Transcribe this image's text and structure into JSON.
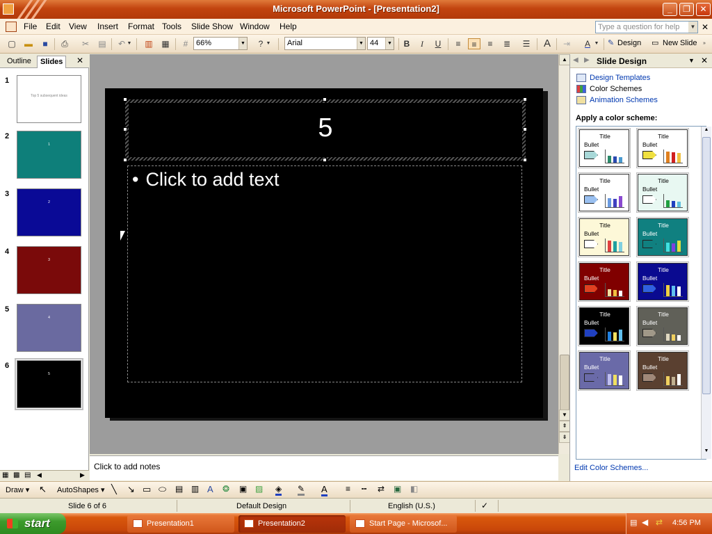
{
  "window": {
    "title": "Microsoft PowerPoint - [Presentation2]"
  },
  "menu": {
    "items": [
      "File",
      "Edit",
      "View",
      "Insert",
      "Format",
      "Tools",
      "Slide Show",
      "Window",
      "Help"
    ],
    "ask_placeholder": "Type a question for help"
  },
  "toolbar": {
    "zoom": "66%",
    "font": "Arial",
    "font_size": "44",
    "design_label": "Design",
    "new_slide_label": "New Slide"
  },
  "left_pane": {
    "tabs": [
      "Outline",
      "Slides"
    ],
    "active_tab": "Slides",
    "slides": [
      {
        "num": "1",
        "bg": "#ffffff",
        "text": "Top 5 subsequent ideas",
        "text_color": "#888888"
      },
      {
        "num": "2",
        "bg": "#0e7f7a",
        "text": "1",
        "text_color": "#ffffff"
      },
      {
        "num": "3",
        "bg": "#0a0a96",
        "text": "2",
        "text_color": "#ffffff"
      },
      {
        "num": "4",
        "bg": "#7a0a0a",
        "text": "3",
        "text_color": "#ffffff"
      },
      {
        "num": "5",
        "bg": "#6a6aa0",
        "text": "4",
        "text_color": "#ffffff"
      },
      {
        "num": "6",
        "bg": "#000000",
        "text": "5",
        "text_color": "#ffffff"
      }
    ],
    "selected_slide": 6
  },
  "slide": {
    "title": "5",
    "body_placeholder": "Click to add text",
    "bullet": "•"
  },
  "notes": {
    "placeholder": "Click to add notes"
  },
  "task_pane": {
    "title": "Slide Design",
    "links": [
      "Design Templates",
      "Color Schemes",
      "Animation Schemes"
    ],
    "heading": "Apply a color scheme:",
    "scheme_title": "Title",
    "scheme_bullet": "Bullet",
    "schemes": [
      {
        "bg": "#ffffff",
        "text": "#000000",
        "arrow": "#a8d8d8",
        "bars": [
          "#2a8a6a",
          "#2a4ab0",
          "#4a9ad0"
        ]
      },
      {
        "bg": "#ffffff",
        "text": "#000000",
        "arrow": "#f0e040",
        "bars": [
          "#e08020",
          "#d02020",
          "#f0c040"
        ]
      },
      {
        "bg": "#ffffff",
        "text": "#000000",
        "arrow": "#9ac0f0",
        "bars": [
          "#6a9ae0",
          "#4040c0",
          "#8a4ad0"
        ]
      },
      {
        "bg": "#e8f8f2",
        "text": "#000000",
        "arrow": "#ffffff",
        "bars": [
          "#20a040",
          "#2040c0",
          "#60c0e0"
        ]
      },
      {
        "bg": "#fdf8d8",
        "text": "#000000",
        "arrow": "#ffffff",
        "bars": [
          "#e04040",
          "#20a0a0",
          "#80d0e0"
        ]
      },
      {
        "bg": "#108080",
        "text": "#ffffff",
        "arrow": "#108080",
        "bars": [
          "#40e0e0",
          "#8040e0",
          "#e0e040"
        ]
      },
      {
        "bg": "#800000",
        "text": "#ffffff",
        "arrow": "#e04020",
        "bars": [
          "#f0e0a0",
          "#f0c040",
          "#ffffff"
        ]
      },
      {
        "bg": "#0a0a90",
        "text": "#ffffff",
        "arrow": "#3060e0",
        "bars": [
          "#f0d040",
          "#60c0f0",
          "#ffffff"
        ]
      },
      {
        "bg": "#000000",
        "text": "#ffffff",
        "arrow": "#2040c0",
        "bars": [
          "#2080e0",
          "#f0e060",
          "#60c0f0"
        ]
      },
      {
        "bg": "#606058",
        "text": "#ffffff",
        "arrow": "#a09888",
        "bars": [
          "#e0d8c0",
          "#f0d060",
          "#ffffff"
        ]
      },
      {
        "bg": "#6a6aa8",
        "text": "#ffffff",
        "arrow": "#6a6aa8",
        "bars": [
          "#c0c0f0",
          "#f0e060",
          "#ffffff"
        ]
      },
      {
        "bg": "#5a4030",
        "text": "#ffffff",
        "arrow": "#a08878",
        "bars": [
          "#f0d060",
          "#c0b090",
          "#ffffff"
        ]
      }
    ],
    "edit_link": "Edit Color Schemes..."
  },
  "drawbar": {
    "draw_label": "Draw",
    "autoshapes_label": "AutoShapes"
  },
  "status": {
    "slide": "Slide 6 of 6",
    "design": "Default Design",
    "language": "English (U.S.)"
  },
  "taskbar": {
    "start": "start",
    "buttons": [
      "Presentation1",
      "Presentation2",
      "Start Page - Microsof..."
    ],
    "active_button": 1,
    "clock": "4:56 PM"
  }
}
